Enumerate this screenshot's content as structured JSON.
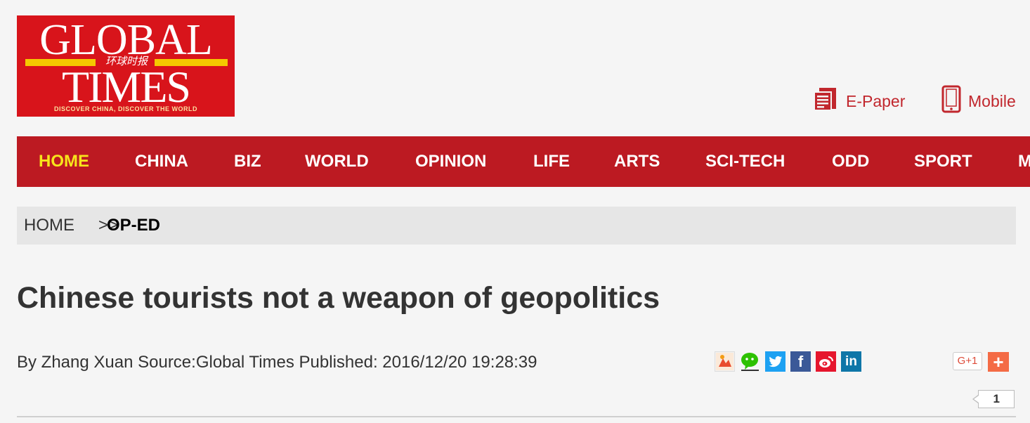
{
  "logo": {
    "line1": "GLOBAL",
    "line2": "TIMES",
    "chinese": "环球时报",
    "tagline": "DISCOVER CHINA, DISCOVER THE WORLD"
  },
  "top_links": {
    "epaper": "E-Paper",
    "mobile": "Mobile"
  },
  "nav": {
    "items": [
      "HOME",
      "CHINA",
      "BIZ",
      "WORLD",
      "OPINION",
      "LIFE",
      "ARTS",
      "SCI-TECH",
      "ODD",
      "SPORT",
      "M"
    ],
    "active": "HOME"
  },
  "breadcrumb": {
    "home": "HOME",
    "separator": ">>",
    "current": "OP-ED"
  },
  "article": {
    "title": "Chinese tourists not a weapon of geopolitics",
    "byline": "By Zhang Xuan Source:Global Times Published: 2016/12/20 19:28:39"
  },
  "share": {
    "icons": [
      "renren-icon",
      "wechat-icon",
      "twitter-icon",
      "facebook-icon",
      "weibo-icon",
      "linkedin-icon"
    ],
    "gplus_label": "G+1",
    "plus_label": "+",
    "count": "1"
  },
  "colors": {
    "brand_red": "#bc1a22",
    "logo_red": "#d8141b",
    "active_nav": "#f7e41b",
    "link_red": "#c1272d"
  }
}
